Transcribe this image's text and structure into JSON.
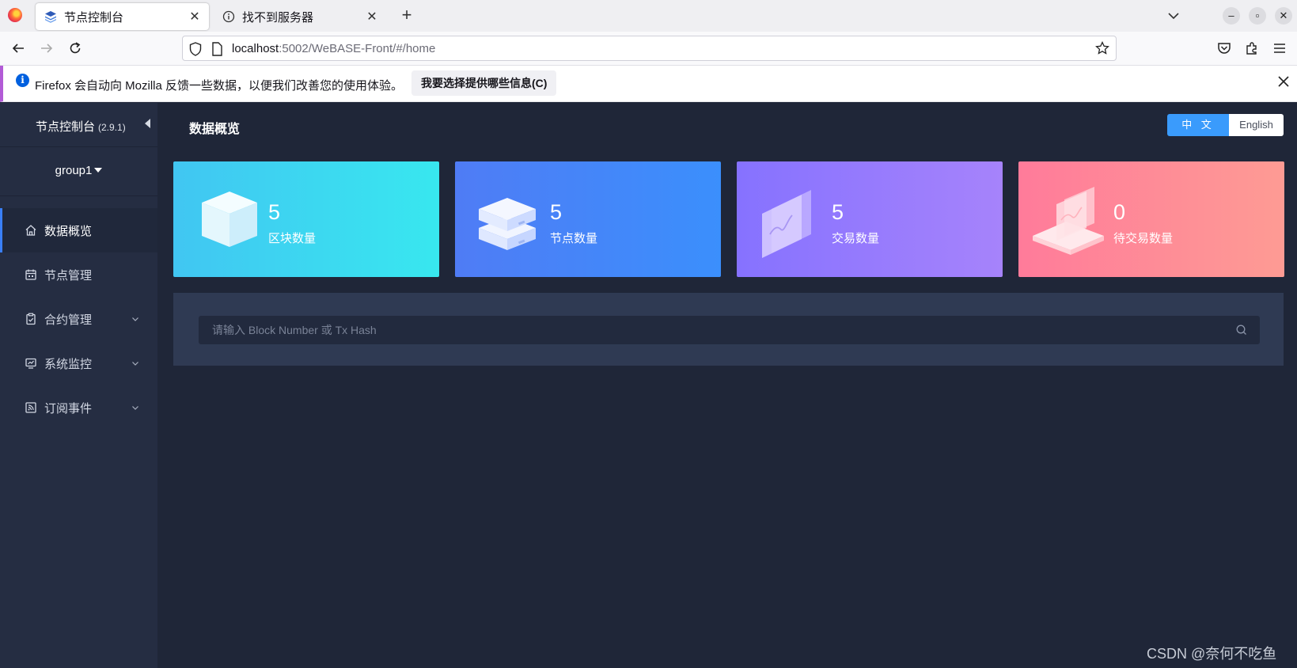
{
  "browser": {
    "tabs": [
      {
        "label": "节点控制台",
        "icon": "layers-icon",
        "active": true
      },
      {
        "label": "找不到服务器",
        "icon": "info-circle-icon",
        "active": false
      }
    ],
    "url": {
      "host": "localhost",
      "path": ":5002/WeBASE-Front/#/home"
    },
    "notification": {
      "message": "Firefox 会自动向 Mozilla 反馈一些数据，以便我们改善您的使用体验。",
      "button": "我要选择提供哪些信息(C)"
    }
  },
  "sidebar": {
    "title": "节点控制台",
    "version": "(2.9.1)",
    "group": "group1",
    "items": [
      {
        "label": "数据概览",
        "icon": "home-icon",
        "active": true,
        "expandable": false
      },
      {
        "label": "节点管理",
        "icon": "calendar-icon",
        "active": false,
        "expandable": false
      },
      {
        "label": "合约管理",
        "icon": "clipboard-icon",
        "active": false,
        "expandable": true
      },
      {
        "label": "系统监控",
        "icon": "monitor-chart-icon",
        "active": false,
        "expandable": true
      },
      {
        "label": "订阅事件",
        "icon": "rss-icon",
        "active": false,
        "expandable": true
      }
    ]
  },
  "main": {
    "title": "数据概览",
    "lang": {
      "zh": "中 文",
      "en": "English",
      "selected": "zh"
    },
    "cards": [
      {
        "value": "5",
        "label": "区块数量",
        "icon": "cube-icon"
      },
      {
        "value": "5",
        "label": "节点数量",
        "icon": "server-stack-icon"
      },
      {
        "value": "5",
        "label": "交易数量",
        "icon": "transaction-panel-icon"
      },
      {
        "value": "0",
        "label": "待交易数量",
        "icon": "pending-transaction-icon"
      }
    ],
    "search": {
      "placeholder": "请输入 Block Number 或 Tx Hash"
    }
  },
  "watermark": "CSDN @奈何不吃鱼",
  "colors": {
    "sidebar_bg": "#252d42",
    "main_bg": "#1f2638",
    "accent": "#3a9bfc",
    "card_block": "#38e7ef",
    "card_node": "#3b8ffc",
    "card_tx": "#a683fb",
    "card_pending": "#fe9b94"
  }
}
